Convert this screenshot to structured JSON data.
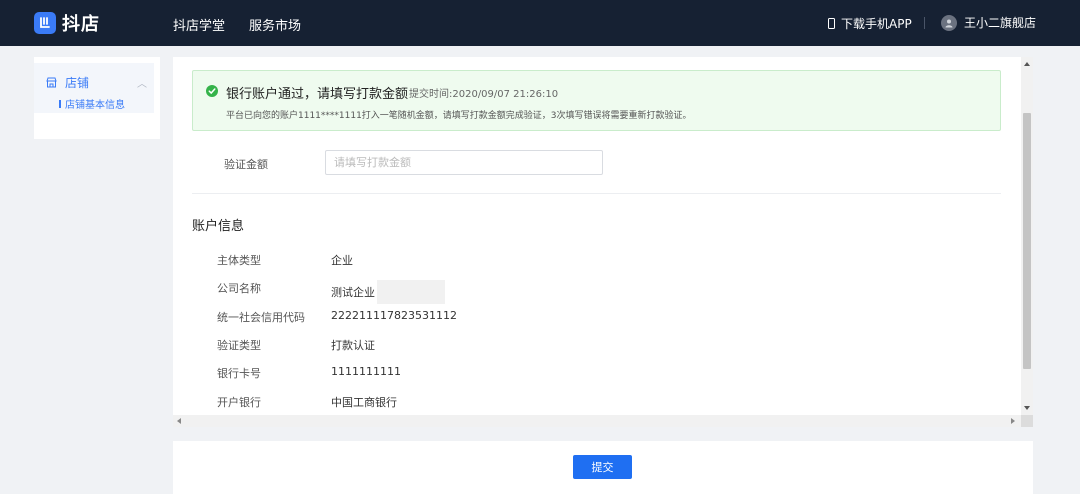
{
  "header": {
    "logo_text": "抖店",
    "nav": [
      "抖店学堂",
      "服务市场"
    ],
    "download_app": "下载手机APP",
    "user_name": "王小二旗舰店"
  },
  "sidebar": {
    "group_label": "店铺",
    "items": [
      {
        "label": "店铺基本信息"
      }
    ]
  },
  "alert": {
    "title": "银行账户通过，请填写打款金额",
    "time": "提交时间:2020/09/07 21:26:10",
    "description": "平台已向您的账户1111****1111打入一笔随机金额，请填写打款金额完成验证，3次填写错误将需要重新打款验证。"
  },
  "verify": {
    "label": "验证金额",
    "placeholder": "请填写打款金额",
    "value": ""
  },
  "account_info": {
    "title": "账户信息",
    "rows": [
      {
        "label": "主体类型",
        "value": "企业"
      },
      {
        "label": "公司名称",
        "value": "测试企业"
      },
      {
        "label": "统一社会信用代码",
        "value": "222211117823531112"
      },
      {
        "label": "验证类型",
        "value": "打款认证"
      },
      {
        "label": "银行卡号",
        "value": "1111111111"
      },
      {
        "label": "开户银行",
        "value": "中国工商银行"
      }
    ]
  },
  "footer": {
    "submit_label": "提交"
  },
  "colors": {
    "header_bg": "#162133",
    "accent": "#1f6ff2",
    "success": "#35b34a",
    "alert_bg": "#effbef"
  }
}
